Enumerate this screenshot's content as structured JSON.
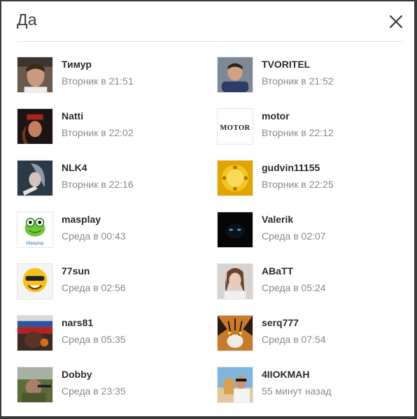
{
  "dialog": {
    "title": "Да",
    "close_icon": "close-icon"
  },
  "users": [
    {
      "name": "Тимур",
      "time": "Вторник в 21:51"
    },
    {
      "name": "TVORITEL",
      "time": "Вторник в 21:52"
    },
    {
      "name": "Natti",
      "time": "Вторник в 22:02"
    },
    {
      "name": "motor",
      "time": "Вторник в 22:12"
    },
    {
      "name": "NLK4",
      "time": "Вторник в 22:16"
    },
    {
      "name": "gudvin11155",
      "time": "Вторник в 22:25"
    },
    {
      "name": "masplay",
      "time": "Среда в 00:43"
    },
    {
      "name": "Valerik",
      "time": "Среда в 02:07"
    },
    {
      "name": "77sun",
      "time": "Среда в 02:56"
    },
    {
      "name": "ABaTT",
      "time": "Среда в 05:24"
    },
    {
      "name": "nars81",
      "time": "Среда в 05:35"
    },
    {
      "name": "serq777",
      "time": "Среда в 07:54"
    },
    {
      "name": "Dobby",
      "time": "Среда в 23:35"
    },
    {
      "name": "4IIOKMAH",
      "time": "55 минут назад"
    }
  ],
  "avatar_labels": {
    "motor": "MOTOR",
    "masplay": "Masplay"
  }
}
